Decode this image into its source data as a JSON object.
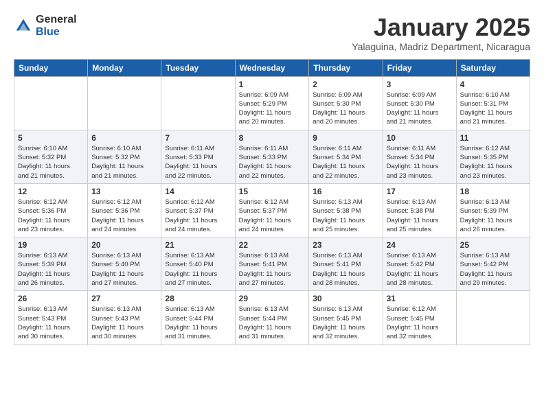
{
  "logo": {
    "general": "General",
    "blue": "Blue"
  },
  "title": "January 2025",
  "subtitle": "Yalaguina, Madriz Department, Nicaragua",
  "days_of_week": [
    "Sunday",
    "Monday",
    "Tuesday",
    "Wednesday",
    "Thursday",
    "Friday",
    "Saturday"
  ],
  "weeks": [
    [
      {
        "day": "",
        "info": ""
      },
      {
        "day": "",
        "info": ""
      },
      {
        "day": "",
        "info": ""
      },
      {
        "day": "1",
        "info": "Sunrise: 6:09 AM\nSunset: 5:29 PM\nDaylight: 11 hours\nand 20 minutes."
      },
      {
        "day": "2",
        "info": "Sunrise: 6:09 AM\nSunset: 5:30 PM\nDaylight: 11 hours\nand 20 minutes."
      },
      {
        "day": "3",
        "info": "Sunrise: 6:09 AM\nSunset: 5:30 PM\nDaylight: 11 hours\nand 21 minutes."
      },
      {
        "day": "4",
        "info": "Sunrise: 6:10 AM\nSunset: 5:31 PM\nDaylight: 11 hours\nand 21 minutes."
      }
    ],
    [
      {
        "day": "5",
        "info": "Sunrise: 6:10 AM\nSunset: 5:32 PM\nDaylight: 11 hours\nand 21 minutes."
      },
      {
        "day": "6",
        "info": "Sunrise: 6:10 AM\nSunset: 5:32 PM\nDaylight: 11 hours\nand 21 minutes."
      },
      {
        "day": "7",
        "info": "Sunrise: 6:11 AM\nSunset: 5:33 PM\nDaylight: 11 hours\nand 22 minutes."
      },
      {
        "day": "8",
        "info": "Sunrise: 6:11 AM\nSunset: 5:33 PM\nDaylight: 11 hours\nand 22 minutes."
      },
      {
        "day": "9",
        "info": "Sunrise: 6:11 AM\nSunset: 5:34 PM\nDaylight: 11 hours\nand 22 minutes."
      },
      {
        "day": "10",
        "info": "Sunrise: 6:11 AM\nSunset: 5:34 PM\nDaylight: 11 hours\nand 23 minutes."
      },
      {
        "day": "11",
        "info": "Sunrise: 6:12 AM\nSunset: 5:35 PM\nDaylight: 11 hours\nand 23 minutes."
      }
    ],
    [
      {
        "day": "12",
        "info": "Sunrise: 6:12 AM\nSunset: 5:36 PM\nDaylight: 11 hours\nand 23 minutes."
      },
      {
        "day": "13",
        "info": "Sunrise: 6:12 AM\nSunset: 5:36 PM\nDaylight: 11 hours\nand 24 minutes."
      },
      {
        "day": "14",
        "info": "Sunrise: 6:12 AM\nSunset: 5:37 PM\nDaylight: 11 hours\nand 24 minutes."
      },
      {
        "day": "15",
        "info": "Sunrise: 6:12 AM\nSunset: 5:37 PM\nDaylight: 11 hours\nand 24 minutes."
      },
      {
        "day": "16",
        "info": "Sunrise: 6:13 AM\nSunset: 5:38 PM\nDaylight: 11 hours\nand 25 minutes."
      },
      {
        "day": "17",
        "info": "Sunrise: 6:13 AM\nSunset: 5:38 PM\nDaylight: 11 hours\nand 25 minutes."
      },
      {
        "day": "18",
        "info": "Sunrise: 6:13 AM\nSunset: 5:39 PM\nDaylight: 11 hours\nand 26 minutes."
      }
    ],
    [
      {
        "day": "19",
        "info": "Sunrise: 6:13 AM\nSunset: 5:39 PM\nDaylight: 11 hours\nand 26 minutes."
      },
      {
        "day": "20",
        "info": "Sunrise: 6:13 AM\nSunset: 5:40 PM\nDaylight: 11 hours\nand 27 minutes."
      },
      {
        "day": "21",
        "info": "Sunrise: 6:13 AM\nSunset: 5:40 PM\nDaylight: 11 hours\nand 27 minutes."
      },
      {
        "day": "22",
        "info": "Sunrise: 6:13 AM\nSunset: 5:41 PM\nDaylight: 11 hours\nand 27 minutes."
      },
      {
        "day": "23",
        "info": "Sunrise: 6:13 AM\nSunset: 5:41 PM\nDaylight: 11 hours\nand 28 minutes."
      },
      {
        "day": "24",
        "info": "Sunrise: 6:13 AM\nSunset: 5:42 PM\nDaylight: 11 hours\nand 28 minutes."
      },
      {
        "day": "25",
        "info": "Sunrise: 6:13 AM\nSunset: 5:42 PM\nDaylight: 11 hours\nand 29 minutes."
      }
    ],
    [
      {
        "day": "26",
        "info": "Sunrise: 6:13 AM\nSunset: 5:43 PM\nDaylight: 11 hours\nand 30 minutes."
      },
      {
        "day": "27",
        "info": "Sunrise: 6:13 AM\nSunset: 5:43 PM\nDaylight: 11 hours\nand 30 minutes."
      },
      {
        "day": "28",
        "info": "Sunrise: 6:13 AM\nSunset: 5:44 PM\nDaylight: 11 hours\nand 31 minutes."
      },
      {
        "day": "29",
        "info": "Sunrise: 6:13 AM\nSunset: 5:44 PM\nDaylight: 11 hours\nand 31 minutes."
      },
      {
        "day": "30",
        "info": "Sunrise: 6:13 AM\nSunset: 5:45 PM\nDaylight: 11 hours\nand 32 minutes."
      },
      {
        "day": "31",
        "info": "Sunrise: 6:12 AM\nSunset: 5:45 PM\nDaylight: 11 hours\nand 32 minutes."
      },
      {
        "day": "",
        "info": ""
      }
    ]
  ]
}
